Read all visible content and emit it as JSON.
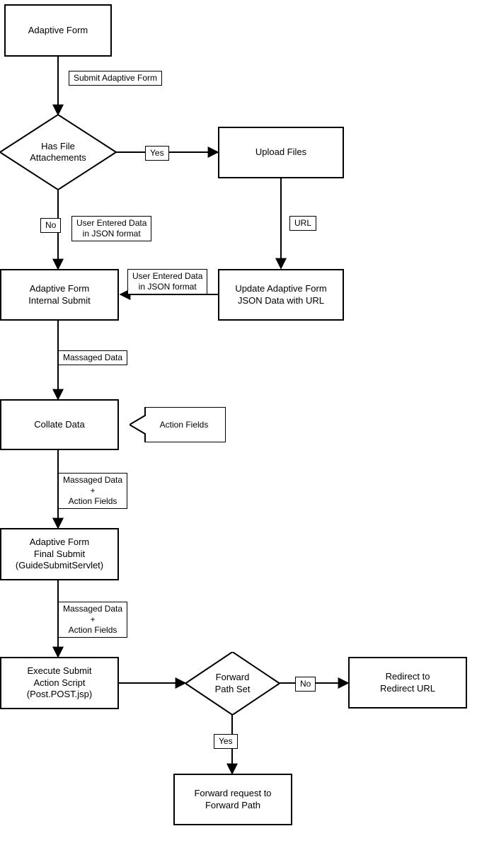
{
  "nodes": {
    "adaptive_form": "Adaptive Form",
    "has_attachments": "Has File\nAttachements",
    "upload_files": "Upload Files",
    "internal_submit": "Adaptive Form\nInternal Submit",
    "update_json": "Update Adaptive Form\nJSON Data with URL",
    "collate": "Collate Data",
    "action_fields_arrow": "Action Fields",
    "final_submit": "Adaptive Form\nFinal Submit\n(GuideSubmitServlet)",
    "exec_script": "Execute Submit\nAction Script\n(Post.POST.jsp)",
    "forward_path_set": "Forward\nPath Set",
    "redirect_url": "Redirect to\nRedirect URL",
    "forward_request": "Forward request to\nForward Path"
  },
  "edges": {
    "submit_form": "Submit Adaptive Form",
    "yes": "Yes",
    "no": "No",
    "url": "URL",
    "user_json": "User Entered Data\nin JSON format",
    "massaged": "Massaged Data",
    "massaged_plus": "Massaged Data\n+\nAction Fields"
  }
}
